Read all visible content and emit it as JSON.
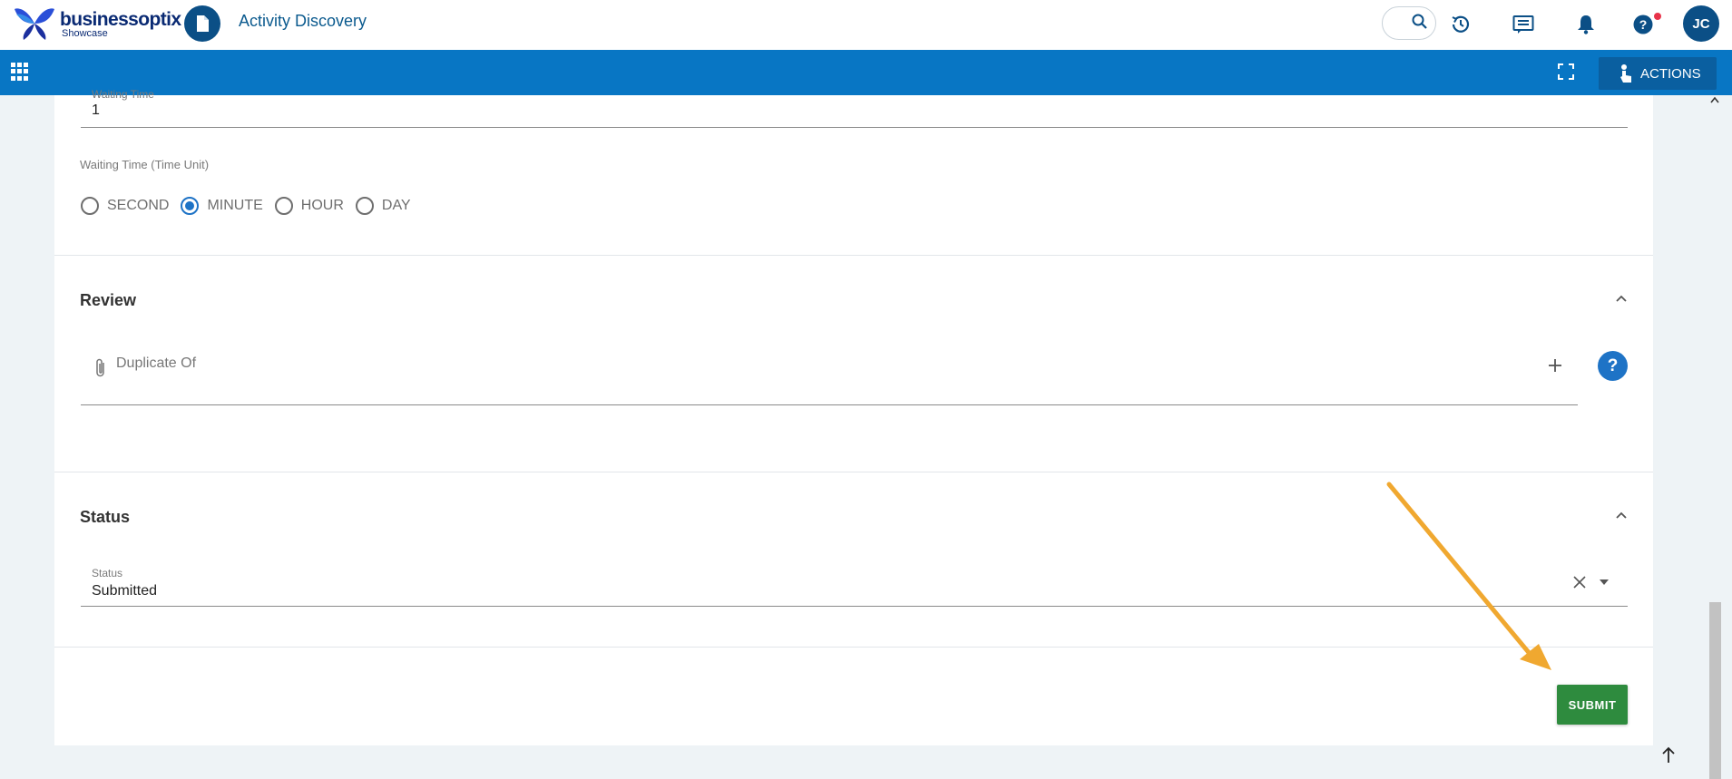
{
  "header": {
    "logo_text": "businessoptix",
    "logo_sub": "Showcase",
    "app_title": "Activity Discovery",
    "avatar_initials": "JC",
    "icons": [
      "search-icon",
      "history-icon",
      "messages-icon",
      "notifications-icon",
      "help-icon"
    ]
  },
  "toolbar": {
    "actions_label": "ACTIONS"
  },
  "waiting": {
    "time_label": "Waiting Time",
    "time_value": "1",
    "unit_label": "Waiting Time (Time Unit)",
    "unit_options": [
      "SECOND",
      "MINUTE",
      "HOUR",
      "DAY"
    ],
    "unit_selected": "MINUTE"
  },
  "review": {
    "title": "Review",
    "duplicate_label": "Duplicate Of",
    "help": "?"
  },
  "status": {
    "title": "Status",
    "field_label": "Status",
    "field_value": "Submitted"
  },
  "footer": {
    "submit_label": "SUBMIT"
  },
  "colors": {
    "primary": "#0876c4",
    "submit": "#2e8b3e",
    "annotation_arrow": "#f0a830"
  }
}
